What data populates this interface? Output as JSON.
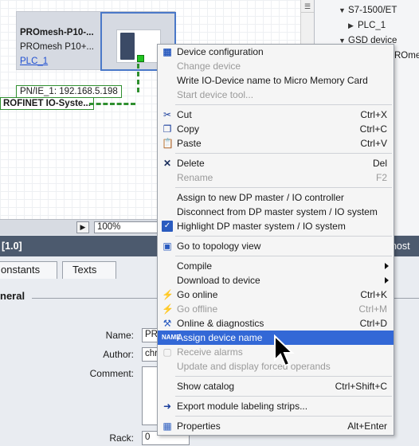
{
  "canvas": {
    "device_name": "PROmesh-P10-...",
    "device_type": "PROmesh  P10+...",
    "device_plc": "PLC_1",
    "ip_label": "PN/IE_1:  192.168.5.198",
    "network_label": "ROFINET IO-Syste..."
  },
  "zoom": {
    "value": "100%"
  },
  "tree": {
    "items": [
      {
        "label": "S7-1500/ET"
      },
      {
        "label": "PLC_1"
      },
      {
        "label": "GSD device"
      },
      {
        "label": "ROme"
      }
    ]
  },
  "properties": {
    "title": "[1.0]",
    "diagnostics_tab": "gnost",
    "tabs": [
      {
        "label": "onstants"
      },
      {
        "label": "Texts"
      }
    ],
    "section": "neral",
    "fields": {
      "name_label": "Name:",
      "name_value": "PRO",
      "author_label": "Author:",
      "author_value": "chr",
      "comment_label": "Comment:",
      "rack_label": "Rack:",
      "rack_value": "0"
    }
  },
  "context_menu": {
    "items": [
      {
        "label": "Device configuration",
        "shortcut": "",
        "icon": "device-config-icon",
        "disabled": false
      },
      {
        "label": "Change device",
        "shortcut": "",
        "icon": "",
        "disabled": true
      },
      {
        "label": "Write IO-Device name to Micro Memory Card",
        "shortcut": "",
        "icon": "",
        "disabled": false
      },
      {
        "label": "Start device tool...",
        "shortcut": "",
        "icon": "",
        "disabled": true
      },
      {
        "label": "Cut",
        "shortcut": "Ctrl+X",
        "icon": "scissors-icon",
        "disabled": false
      },
      {
        "label": "Copy",
        "shortcut": "Ctrl+C",
        "icon": "copy-icon",
        "disabled": false
      },
      {
        "label": "Paste",
        "shortcut": "Ctrl+V",
        "icon": "paste-icon",
        "disabled": false
      },
      {
        "label": "Delete",
        "shortcut": "Del",
        "icon": "delete-x-icon",
        "disabled": false
      },
      {
        "label": "Rename",
        "shortcut": "F2",
        "icon": "",
        "disabled": true
      },
      {
        "label": "Assign to new DP master / IO controller",
        "shortcut": "",
        "icon": "",
        "disabled": false
      },
      {
        "label": "Disconnect from DP master system / IO system",
        "shortcut": "",
        "icon": "",
        "disabled": false
      },
      {
        "label": "Highlight DP master system / IO system",
        "shortcut": "",
        "icon": "checkbox-checked-icon",
        "disabled": false
      },
      {
        "label": "Go to topology view",
        "shortcut": "",
        "icon": "topology-icon",
        "disabled": false
      },
      {
        "label": "Compile",
        "shortcut": "",
        "icon": "",
        "disabled": false,
        "submenu": true
      },
      {
        "label": "Download to device",
        "shortcut": "",
        "icon": "",
        "disabled": false,
        "submenu": true
      },
      {
        "label": "Go online",
        "shortcut": "Ctrl+K",
        "icon": "go-online-icon",
        "disabled": false
      },
      {
        "label": "Go offline",
        "shortcut": "Ctrl+M",
        "icon": "go-offline-icon",
        "disabled": true
      },
      {
        "label": "Online & diagnostics",
        "shortcut": "Ctrl+D",
        "icon": "diagnostics-icon",
        "disabled": false
      },
      {
        "label": "Assign device name",
        "shortcut": "",
        "icon": "assign-name-icon",
        "disabled": false,
        "highlighted": true
      },
      {
        "label": "Receive alarms",
        "shortcut": "",
        "icon": "alarm-icon",
        "disabled": true
      },
      {
        "label": "Update and display forced operands",
        "shortcut": "",
        "icon": "",
        "disabled": true
      },
      {
        "label": "Show catalog",
        "shortcut": "Ctrl+Shift+C",
        "icon": "",
        "disabled": false
      },
      {
        "label": "Export module labeling strips...",
        "shortcut": "",
        "icon": "export-icon",
        "disabled": false
      },
      {
        "label": "Properties",
        "shortcut": "Alt+Enter",
        "icon": "properties-icon",
        "disabled": false
      }
    ]
  },
  "colors": {
    "highlight": "#3368d6",
    "network_green": "#2f8f2f",
    "header_dark": "#4c5a6e"
  }
}
